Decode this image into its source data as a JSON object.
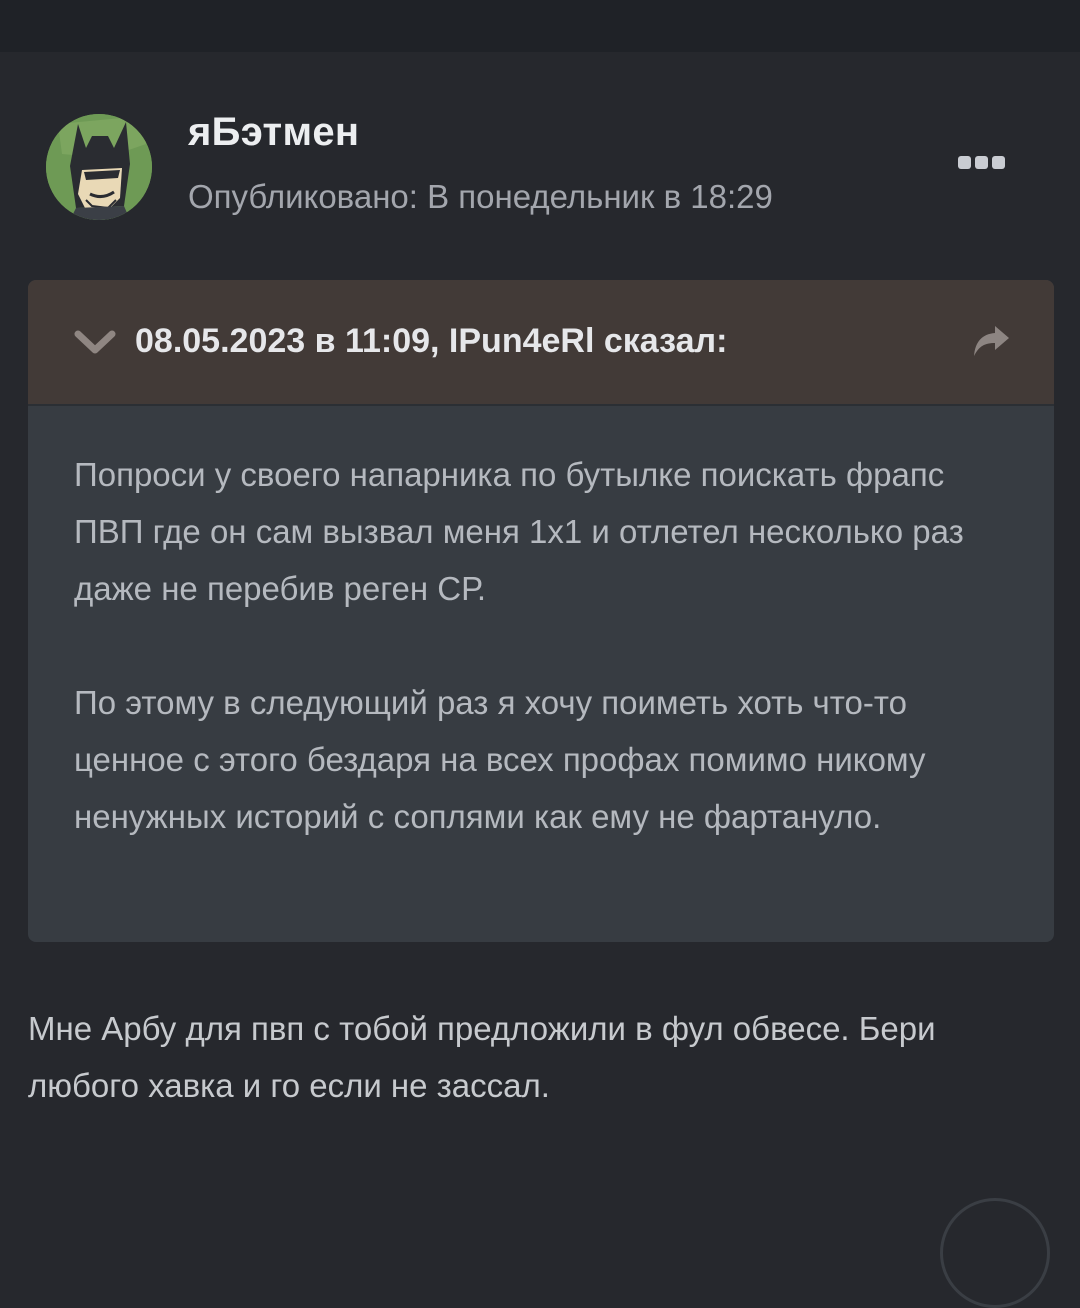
{
  "post": {
    "author": "яБэтмен",
    "published": "Опубликовано: В понедельник в 18:29",
    "more_icon": "ellipsis-icon"
  },
  "quote": {
    "meta": "08.05.2023 в 11:09, IPun4eRl сказал:",
    "collapse_icon": "chevron-down-icon",
    "share_icon": "share-arrow-icon",
    "paragraphs": [
      "Попроси у своего напарника по бутылке поискать фрапс ПВП где он сам вызвал меня 1х1 и отлетел несколько раз даже не перебив реген СР.",
      "По этому в следующий раз я хочу поиметь хоть что-то ценное с этого бездаря на всех профах помимо никому ненужных историй с соплями как ему не фартануло."
    ]
  },
  "reply": {
    "text": "Мне Арбу для пвп с тобой предложили в фул обвесе. Бери любого хавка и го если не зассал."
  },
  "colors": {
    "background": "#26282d",
    "quote_header": "#423a37",
    "quote_body": "#373c42",
    "avatar_bg": "#6e9a55"
  }
}
